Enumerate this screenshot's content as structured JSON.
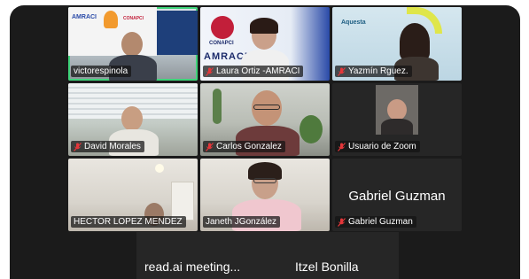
{
  "participants": [
    {
      "name": "victorespinola",
      "muted": false,
      "active": true,
      "logo_text": "AMRACI",
      "logo_sub": "CONAPCI"
    },
    {
      "name": "Laura Ortiz -AMRACI",
      "muted": true,
      "logo_text": "CONAPCI",
      "banner": "AMRACI"
    },
    {
      "name": "Yazmín Rguez.",
      "muted": true,
      "brand": "Aquesta"
    },
    {
      "name": "David Morales",
      "muted": true
    },
    {
      "name": "Carlos Gonzalez",
      "muted": true
    },
    {
      "name": "Usuario de Zoom",
      "muted": true
    },
    {
      "name": "HECTOR LOPEZ MENDEZ",
      "muted": false
    },
    {
      "name": "Janeth JGonzález",
      "muted": false
    },
    {
      "name": "Gabriel Guzman",
      "muted": true,
      "display_text": "Gabriel Guzman"
    }
  ],
  "bottom_row": [
    "read.ai meeting...",
    "Itzel Bonilla"
  ],
  "colors": {
    "active_border": "#3fd37a",
    "mute_red": "#e5373a",
    "window_bg": "#1b1b1b"
  }
}
